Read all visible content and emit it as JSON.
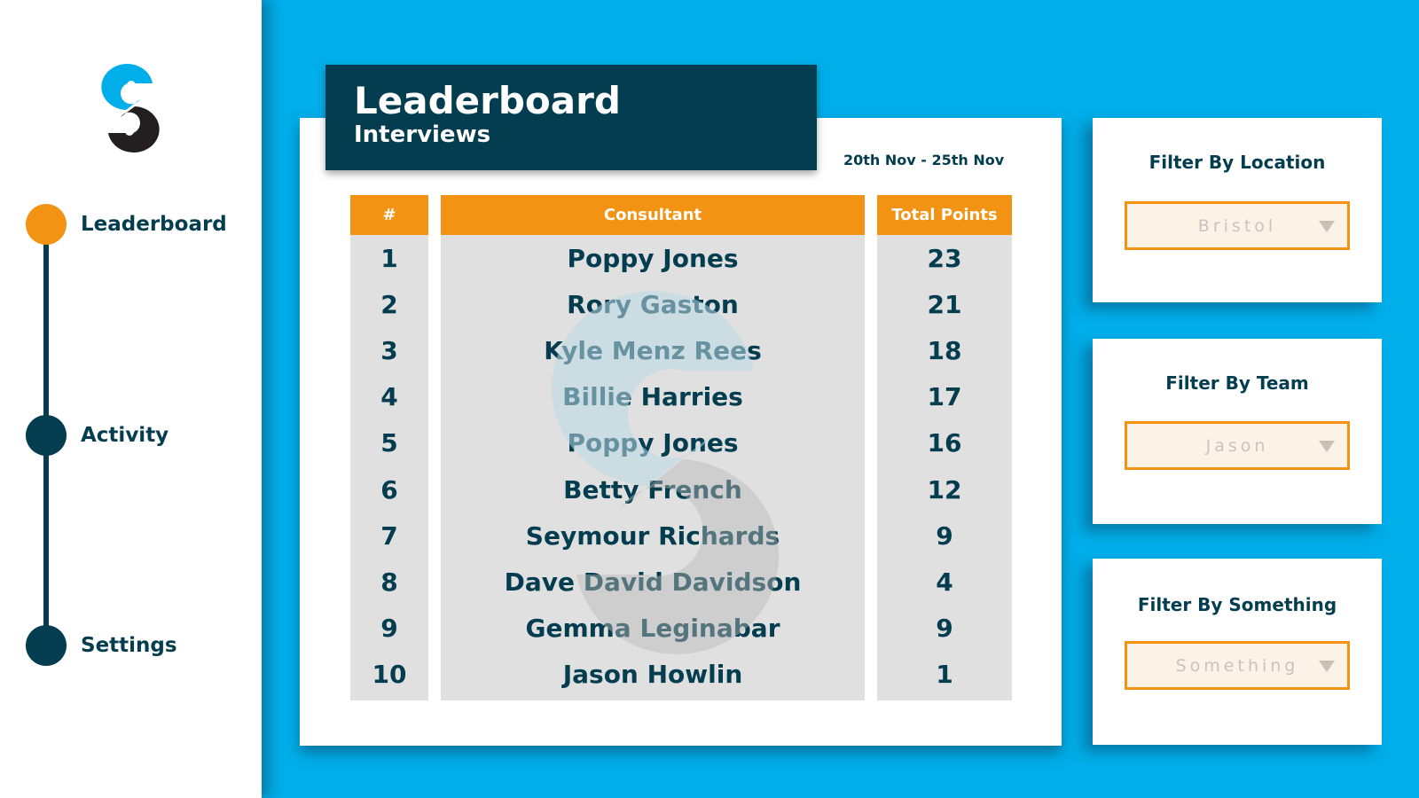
{
  "sidebar": {
    "logo": "s-dollar-logo",
    "items": [
      {
        "label": "Leaderboard",
        "active": true
      },
      {
        "label": "Activity",
        "active": false
      },
      {
        "label": "Settings",
        "active": false
      }
    ]
  },
  "header": {
    "title": "Leaderboard",
    "subtitle": "Interviews",
    "date_range": "20th Nov - 25th Nov"
  },
  "table": {
    "columns": [
      "#",
      "Consultant",
      "Total Points"
    ],
    "rows": [
      {
        "rank": "1",
        "name": "Poppy Jones",
        "points": "23"
      },
      {
        "rank": "2",
        "name": "Rory Gaston",
        "points": "21"
      },
      {
        "rank": "3",
        "name": "Kyle Menz Rees",
        "points": "18"
      },
      {
        "rank": "4",
        "name": "Billie Harries",
        "points": "17"
      },
      {
        "rank": "5",
        "name": "Poppy Jones",
        "points": "16"
      },
      {
        "rank": "6",
        "name": "Betty French",
        "points": "12"
      },
      {
        "rank": "7",
        "name": "Seymour Richards",
        "points": "9"
      },
      {
        "rank": "8",
        "name": "Dave David Davidson",
        "points": "4"
      },
      {
        "rank": "9",
        "name": "Gemma Leginabar",
        "points": "9"
      },
      {
        "rank": "10",
        "name": "Jason Howlin",
        "points": "1"
      }
    ]
  },
  "filters": [
    {
      "title": "Filter By Location",
      "value": "Bristol"
    },
    {
      "title": "Filter By Team",
      "value": "Jason"
    },
    {
      "title": "Filter By Something",
      "value": "Something"
    }
  ],
  "colors": {
    "background": "#00aee9",
    "navy": "#033d4f",
    "orange": "#f39313",
    "cell_grey": "#e0e0e0",
    "select_bg": "#fdf2e6"
  }
}
